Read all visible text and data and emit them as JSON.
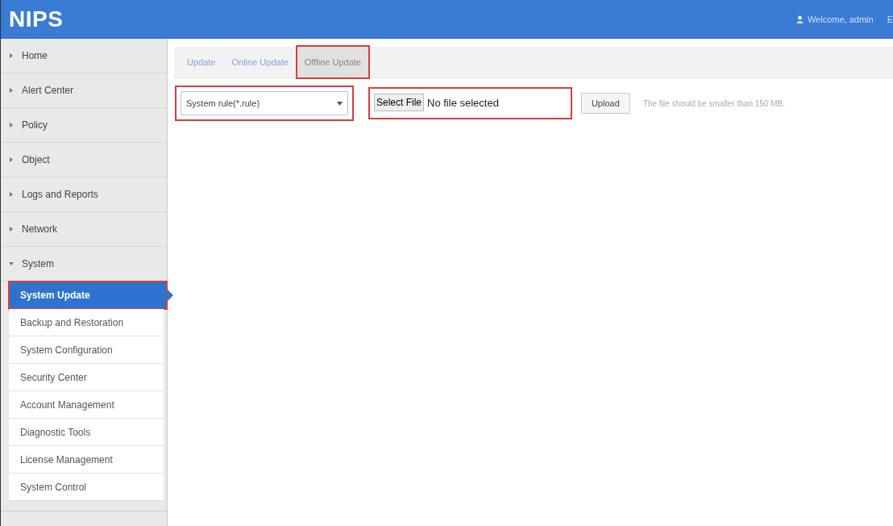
{
  "header": {
    "logo": "NIPS",
    "welcome": "Welcome, admin",
    "exit": "E"
  },
  "sidebar": {
    "items": [
      {
        "label": "Home",
        "expanded": false
      },
      {
        "label": "Alert Center",
        "expanded": false
      },
      {
        "label": "Policy",
        "expanded": false
      },
      {
        "label": "Object",
        "expanded": false
      },
      {
        "label": "Logs and Reports",
        "expanded": false
      },
      {
        "label": "Network",
        "expanded": false
      },
      {
        "label": "System",
        "expanded": true,
        "children": [
          {
            "label": "System Update",
            "selected": true,
            "highlighted": true
          },
          {
            "label": "Backup and Restoration",
            "selected": false,
            "highlighted": false
          },
          {
            "label": "System Configuration",
            "selected": false,
            "highlighted": false
          },
          {
            "label": "Security Center",
            "selected": false,
            "highlighted": false
          },
          {
            "label": "Account Management",
            "selected": false,
            "highlighted": false
          },
          {
            "label": "Diagnostic Tools",
            "selected": false,
            "highlighted": false
          },
          {
            "label": "License Management",
            "selected": false,
            "highlighted": false
          },
          {
            "label": "System Control",
            "selected": false,
            "highlighted": false
          }
        ]
      }
    ]
  },
  "tabs": [
    {
      "label": "Update",
      "selected": false,
      "highlighted": false
    },
    {
      "label": "Online Update",
      "selected": false,
      "highlighted": false
    },
    {
      "label": "Offline Update",
      "selected": true,
      "highlighted": true
    }
  ],
  "form": {
    "rule_select": {
      "value": "System rule(*.rule)",
      "highlighted": true
    },
    "file_input": {
      "button": "Select File",
      "status": "No file selected",
      "highlighted": true
    },
    "upload_button": "Upload",
    "hint": "The file should be smaller than 150 MB."
  }
}
